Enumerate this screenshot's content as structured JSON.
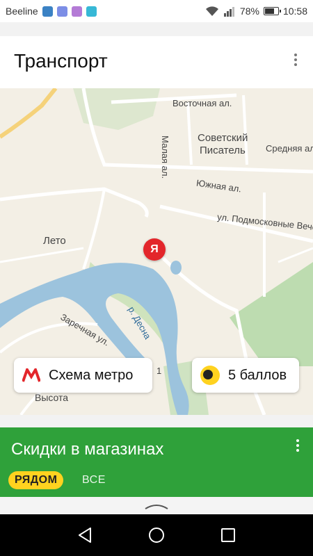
{
  "status_bar": {
    "carrier": "Beeline",
    "battery": "78%",
    "battery_level": 0.78,
    "time": "10:58",
    "icons": [
      "shield-icon",
      "vpn-icon",
      "image-icon",
      "download-icon",
      "wifi-icon",
      "signal-icon",
      "battery-icon"
    ]
  },
  "transport_card": {
    "title": "Транспорт",
    "map": {
      "labels": {
        "vostochnaya": "Восточная ал.",
        "malaya": "Малая ал.",
        "sovetsky": "Советский",
        "pisatel": "Писатель",
        "srednyaya": "Средняя ал.",
        "yuzhnaya": "Южная ал.",
        "podmoskovnye": "ул. Подмосковные Вече",
        "leto": "Лето",
        "desna": "р. Десна",
        "zarechnaya": "Заречная ул.",
        "vysota": "Высота",
        "num1": "1"
      },
      "pin_label": "Я"
    },
    "metro_button": "Схема метро",
    "points_button": "5 баллов"
  },
  "discounts_card": {
    "title": "Скидки в магазинах",
    "tabs": [
      {
        "label": "РЯДОМ",
        "active": true
      },
      {
        "label": "ВСЕ",
        "active": false
      }
    ]
  },
  "colors": {
    "accent_green": "#2fa13a",
    "accent_yellow": "#ffd21f",
    "pin_red": "#e3262b",
    "river": "#9cc3dd"
  }
}
